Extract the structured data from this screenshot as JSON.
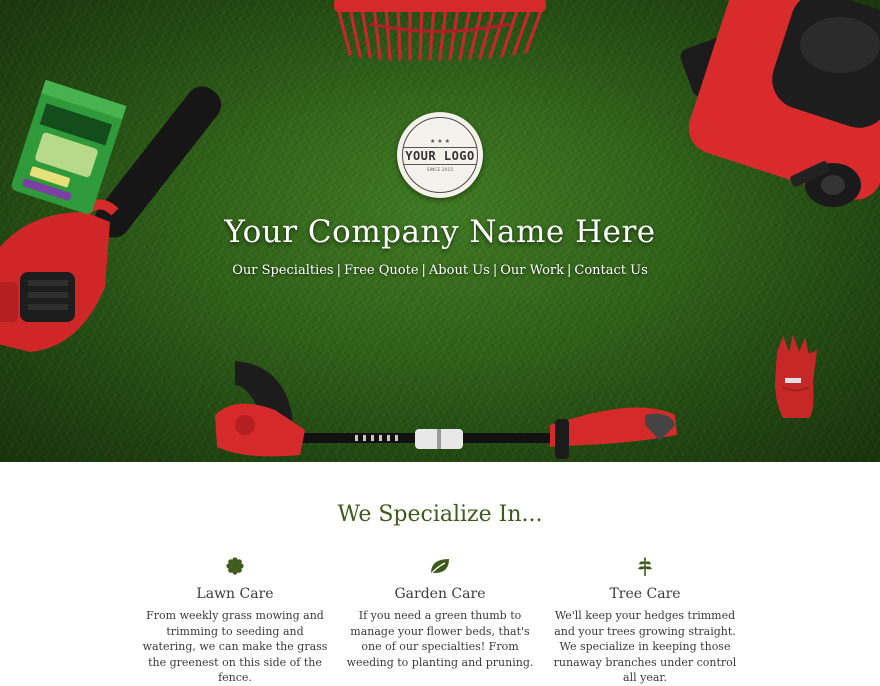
{
  "hero": {
    "logo": {
      "text": "YOUR LOGO",
      "stars": "★ ★ ★",
      "subtext": "SINCE 2015"
    },
    "company_name": "Your Company Name Here",
    "nav": [
      {
        "label": "Our Specialties"
      },
      {
        "label": "Free Quote"
      },
      {
        "label": "About Us"
      },
      {
        "label": "Our Work"
      },
      {
        "label": "Contact Us"
      }
    ],
    "nav_separator": "|"
  },
  "specialties": {
    "title": "We Specialize In...",
    "items": [
      {
        "icon": "flower-icon",
        "title": "Lawn Care",
        "text": "From weekly grass mowing and trimming to seeding and watering, we can make the grass the greenest on this side of the fence."
      },
      {
        "icon": "leaf-icon",
        "title": "Garden Care",
        "text": "If you need a green thumb to manage your flower beds, that's one of our specialties! From weeding to planting and pruning."
      },
      {
        "icon": "tree-icon",
        "title": "Tree Care",
        "text": "We'll keep your hedges trimmed and your trees growing straight. We specialize in keeping those runaway branches under control all year."
      }
    ]
  },
  "colors": {
    "accent_green": "#3e5a1c",
    "tool_red": "#d42a2a",
    "grass": "#2d5e17"
  }
}
